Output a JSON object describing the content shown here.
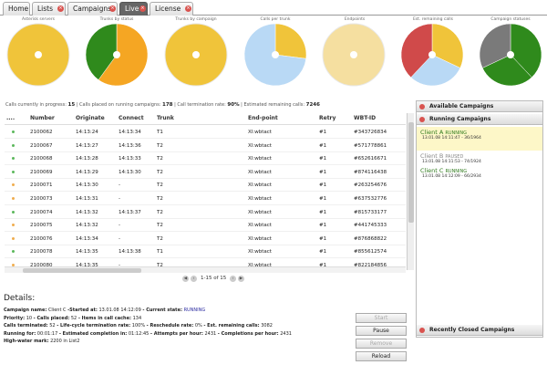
{
  "tabs": [
    {
      "label": "Home",
      "badge": false
    },
    {
      "label": "Lists",
      "badge": true
    },
    {
      "label": "Campaigns",
      "badge": true
    },
    {
      "label": "Live",
      "badge": true,
      "active": true
    },
    {
      "label": "License",
      "badge": true
    }
  ],
  "pies": [
    {
      "label": "Asterisk servers",
      "slices": [
        {
          "v": 1,
          "c": "#f0c43a"
        }
      ]
    },
    {
      "label": "Trunks by status",
      "slices": [
        {
          "v": 60,
          "c": "#f5a623"
        },
        {
          "v": 40,
          "c": "#2f8a1c"
        }
      ]
    },
    {
      "label": "Trunks by campaign",
      "slices": [
        {
          "v": 1,
          "c": "#f0c43a"
        }
      ]
    },
    {
      "label": "Calls per trunk",
      "slices": [
        {
          "v": 27,
          "c": "#f0c43a"
        },
        {
          "v": 73,
          "c": "#b9d9f5"
        }
      ]
    },
    {
      "label": "Endpoints",
      "slices": [
        {
          "v": 1,
          "c": "#f5dfa0"
        }
      ]
    },
    {
      "label": "Est. remaining calls",
      "slices": [
        {
          "v": 32,
          "c": "#f0c43a"
        },
        {
          "v": 30,
          "c": "#b9d9f5"
        },
        {
          "v": 38,
          "c": "#d04a4a"
        }
      ]
    },
    {
      "label": "Campaign statuses",
      "slices": [
        {
          "v": 38,
          "c": "#2f8a1c"
        },
        {
          "v": 30,
          "c": "#2f8a1c"
        },
        {
          "v": 32,
          "c": "#7a7a7a"
        }
      ]
    }
  ],
  "stats": {
    "in_progress_label": "Calls currently in progress:",
    "in_progress": "15",
    "placed_label": "Calls placed on running campaigns:",
    "placed": "178",
    "termination_label": "Call termination rate:",
    "termination": "90%",
    "remaining_label": "Estimated remaining calls:",
    "remaining": "7246"
  },
  "columns": [
    "....",
    "Number",
    "Originate",
    "Connect",
    "Trunk",
    "End-point",
    "Retry",
    "WBT-ID"
  ],
  "rows": [
    {
      "status": "green",
      "number": "2100062",
      "originate": "14:13:24",
      "connect": "14:13:34",
      "trunk": "T1",
      "endpoint": "XI:wbtact",
      "retry": "#1",
      "wbtid": "#343726834"
    },
    {
      "status": "green",
      "number": "2100067",
      "originate": "14:13:27",
      "connect": "14:13:36",
      "trunk": "T2",
      "endpoint": "XI:wbtact",
      "retry": "#1",
      "wbtid": "#571778861"
    },
    {
      "status": "green",
      "number": "2100068",
      "originate": "14:13:28",
      "connect": "14:13:33",
      "trunk": "T2",
      "endpoint": "XI:wbtact",
      "retry": "#1",
      "wbtid": "#652616671"
    },
    {
      "status": "green",
      "number": "2100069",
      "originate": "14:13:29",
      "connect": "14:13:30",
      "trunk": "T2",
      "endpoint": "XI:wbtact",
      "retry": "#1",
      "wbtid": "#874116438"
    },
    {
      "status": "orange",
      "number": "2100071",
      "originate": "14:13:30",
      "connect": "-",
      "trunk": "T2",
      "endpoint": "XI:wbtact",
      "retry": "#1",
      "wbtid": "#263254676"
    },
    {
      "status": "orange",
      "number": "2100073",
      "originate": "14:13:31",
      "connect": "-",
      "trunk": "T2",
      "endpoint": "XI:wbtact",
      "retry": "#1",
      "wbtid": "#637532776"
    },
    {
      "status": "green",
      "number": "2100074",
      "originate": "14:13:32",
      "connect": "14:13:37",
      "trunk": "T2",
      "endpoint": "XI:wbtact",
      "retry": "#1",
      "wbtid": "#815733177"
    },
    {
      "status": "orange",
      "number": "2100075",
      "originate": "14:13:32",
      "connect": "-",
      "trunk": "T2",
      "endpoint": "XI:wbtact",
      "retry": "#1",
      "wbtid": "#441745333"
    },
    {
      "status": "orange",
      "number": "2100076",
      "originate": "14:13:34",
      "connect": "-",
      "trunk": "T2",
      "endpoint": "XI:wbtact",
      "retry": "#1",
      "wbtid": "#876868822"
    },
    {
      "status": "green",
      "number": "2100078",
      "originate": "14:13:35",
      "connect": "14:13:38",
      "trunk": "T1",
      "endpoint": "XI:wbtact",
      "retry": "#1",
      "wbtid": "#855612574"
    },
    {
      "status": "orange",
      "number": "2100080",
      "originate": "14:13:35",
      "connect": "-",
      "trunk": "T2",
      "endpoint": "XI:wbtact",
      "retry": "#1",
      "wbtid": "#822184856"
    }
  ],
  "pager": {
    "text": "1-15 of 15"
  },
  "sidebar": {
    "available_label": "Available Campaigns",
    "running_label": "Running Campaigns",
    "closed_label": "Recently Closed Campaigns",
    "campaigns": [
      {
        "name": "Client A",
        "status": "RUNNING",
        "status_color": "#2f7a1c",
        "detail": "13.01.08 14:11:47 - 36/1964",
        "highlight": true
      },
      {
        "name": "Client B",
        "status": "PAUSED",
        "status_color": "#888888",
        "detail": "13.01.08 14:11:53 - 74/1924",
        "highlight": false
      },
      {
        "name": "Client C",
        "status": "RUNNING",
        "status_color": "#2f7a1c",
        "detail": "13.01.08 14:12:09 - 66/2934",
        "highlight": false
      }
    ]
  },
  "details": {
    "title": "Details:",
    "line1": {
      "k1": "Campaign name:",
      "v1": "Client C",
      "k2": " -Started at:",
      "v2": "13.01.08 14:12:09",
      "k3": " - Current state:",
      "v3": "RUNNING"
    },
    "line2": {
      "k1": "Priority:",
      "v1": "10",
      "k2": " - Calls placed:",
      "v2": "52",
      "k3": " - Items in call cache:",
      "v3": "134"
    },
    "line3": {
      "k1": "Calls terminated:",
      "v1": "52",
      "k2": " - Life-cycle termination rate:",
      "v2": "100%",
      "k3": " - Reschedule rate:",
      "v3": "0%",
      "k4": " - Est. remaining calls:",
      "v4": "3082"
    },
    "line4": {
      "k1": "Running for:",
      "v1": "00:01:17",
      "k2": " - Estimated completion in:",
      "v2": "01:12:45",
      "k3": " - Attempts per hour:",
      "v3": "2431",
      "k4": " - Completions per hour:",
      "v4": "2431"
    },
    "line5": {
      "k1": "High-water mark:",
      "v1": "2200 in List2"
    }
  },
  "buttons": {
    "start": "Start",
    "pause": "Pause",
    "remove": "Remove",
    "reload": "Reload"
  },
  "colors": {
    "green": "#5cb85c",
    "orange": "#f0ad4e",
    "accent": "#d9534f",
    "running": "#2f7a1c"
  }
}
